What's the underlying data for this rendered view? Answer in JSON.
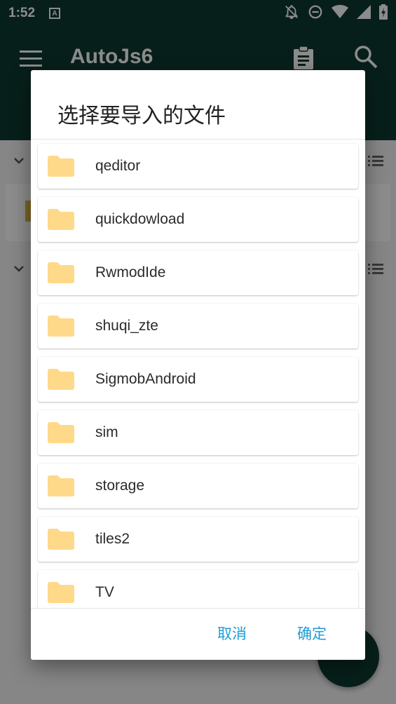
{
  "status_bar": {
    "time": "1:52",
    "app_icon_letter": "A",
    "icons": [
      "notifications-off-icon",
      "do-not-disturb-icon",
      "wifi-icon",
      "cellular-icon",
      "battery-charging-icon"
    ]
  },
  "app_bar": {
    "title": "AutoJs6",
    "color": "#0e3a31"
  },
  "dialog": {
    "title": "选择要导入的文件",
    "folders": [
      {
        "label": "qeditor"
      },
      {
        "label": "quickdowload"
      },
      {
        "label": "RwmodIde"
      },
      {
        "label": "shuqi_zte"
      },
      {
        "label": "SigmobAndroid"
      },
      {
        "label": "sim"
      },
      {
        "label": "storage"
      },
      {
        "label": "tiles2"
      },
      {
        "label": "TV"
      }
    ],
    "cancel_label": "取消",
    "ok_label": "确定",
    "accent_color": "#1e9ed6",
    "folder_color": "#ffd98a"
  }
}
